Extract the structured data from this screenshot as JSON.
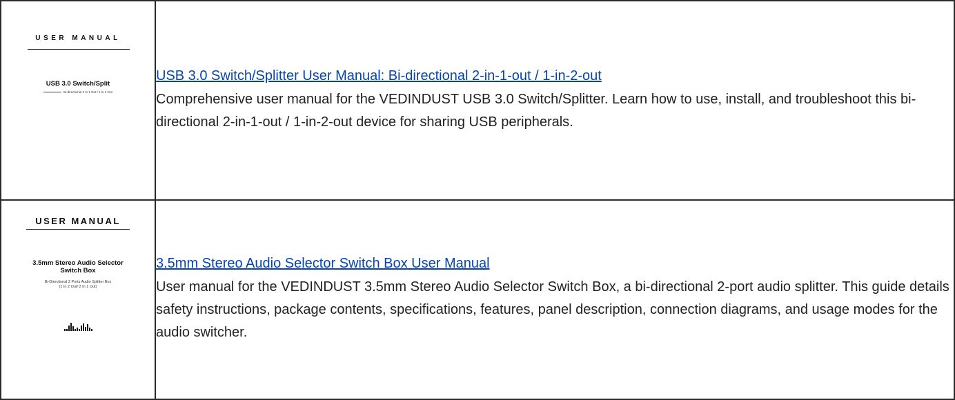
{
  "items": [
    {
      "thumbnail": {
        "heading": "USER MANUAL",
        "title": "USB 3.0 Switch/Split",
        "subtitle": "Bi-directional 2 In 1 Out / 1 In 2 Out"
      },
      "link_text": "USB 3.0 Switch/Splitter User Manual: Bi-directional 2-in-1-out / 1-in-2-out",
      "description": "Comprehensive user manual for the VEDINDUST USB 3.0 Switch/Splitter. Learn how to use, install, and troubleshoot this bi-directional 2-in-1-out / 1-in-2-out device for sharing USB peripherals."
    },
    {
      "thumbnail": {
        "heading": "USER MANUAL",
        "title_line1": "3.5mm Stereo Audio Selector",
        "title_line2": "Switch Box",
        "subtitle_line1": "Bi-Directional 2 Ports Audio Splitter Box",
        "subtitle_line2": "(1 In 2 Out/ 2 In 1 Out)",
        "logo_icon": "audio-level-bars-logo"
      },
      "link_text": "3.5mm Stereo Audio Selector Switch Box User Manual",
      "description": "User manual for the VEDINDUST 3.5mm Stereo Audio Selector Switch Box, a bi-directional 2-port audio splitter. This guide details safety instructions, package contents, specifications, features, panel description, connection diagrams, and usage modes for the audio switcher."
    }
  ],
  "colors": {
    "link": "#0645ad",
    "text": "#222222",
    "border": "#2b2b2b"
  }
}
